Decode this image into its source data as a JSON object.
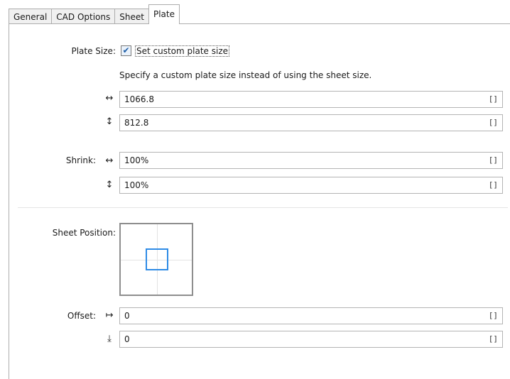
{
  "tabs": [
    {
      "label": "General",
      "active": false
    },
    {
      "label": "CAD Options",
      "active": false
    },
    {
      "label": "Sheet",
      "active": false
    },
    {
      "label": "Plate",
      "active": true
    }
  ],
  "plate_size": {
    "label": "Plate Size:",
    "checkbox_checked": true,
    "checkbox_label": "Set custom plate size",
    "hint": "Specify a custom plate size instead of using the sheet size.",
    "width_icon": "horizontal-arrows-icon",
    "height_icon": "vertical-arrows-icon",
    "width_value": "1066.8",
    "height_value": "812.8",
    "bracket": "[]"
  },
  "shrink": {
    "label": "Shrink:",
    "horizontal_icon": "horizontal-arrows-icon",
    "vertical_icon": "vertical-arrows-icon",
    "horizontal_value": "100%",
    "vertical_value": "100%",
    "bracket": "[]"
  },
  "sheet_position": {
    "label": "Sheet Position:",
    "selected": "center"
  },
  "offset": {
    "label": "Offset:",
    "x_icon": "offset-horizontal-icon",
    "y_icon": "offset-vertical-icon",
    "x_value": "0",
    "y_value": "0",
    "bracket": "[]"
  },
  "colors": {
    "accent": "#2e8be6",
    "border": "#adadad"
  }
}
